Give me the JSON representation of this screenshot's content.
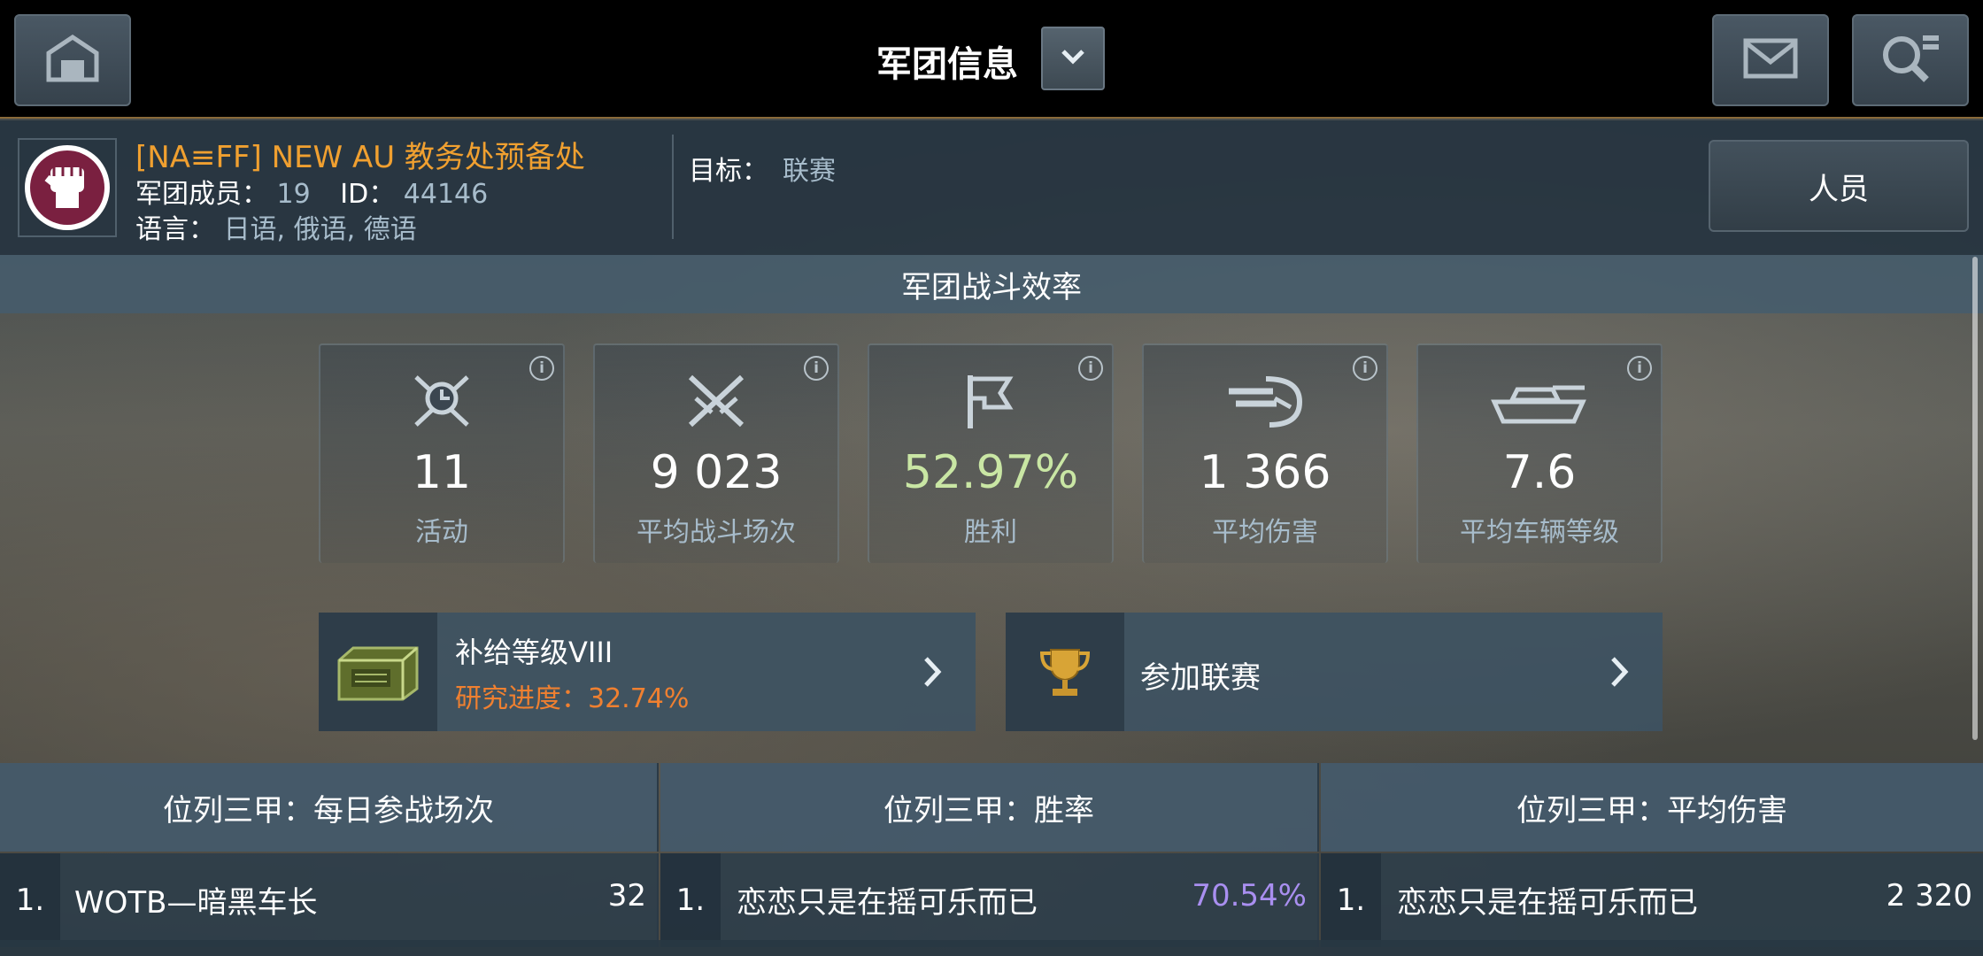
{
  "header": {
    "title": "军团信息"
  },
  "clan": {
    "name": "[NA≡FF] NEW AU 教务处预备处",
    "members_label": "军团成员：",
    "members_value": "19",
    "id_label": "ID：",
    "id_value": "44146",
    "lang_label": "语言：",
    "lang_value": "日语, 俄语, 德语",
    "goal_label": "目标：",
    "goal_value": "联赛",
    "staff_button": "人员"
  },
  "efficiency": {
    "title": "军团战斗效率",
    "stats": [
      {
        "icon": "activity-icon",
        "value": "11",
        "label": "活动"
      },
      {
        "icon": "battles-icon",
        "value": "9 023",
        "label": "平均战斗场次"
      },
      {
        "icon": "victory-flag-icon",
        "value": "52.97%",
        "label": "胜利",
        "color": "#c9e6a4"
      },
      {
        "icon": "damage-shell-icon",
        "value": "1 366",
        "label": "平均伤害"
      },
      {
        "icon": "tank-icon",
        "value": "7.6",
        "label": "平均车辆等级"
      }
    ]
  },
  "supply": {
    "title": "补给等级VIII",
    "progress_label": "研究进度：",
    "progress_value": "32.74%",
    "progress": 0.3274
  },
  "league": {
    "title": "参加联赛"
  },
  "leaderboards": [
    {
      "title": "位列三甲：每日参战场次",
      "rows": [
        {
          "rank": "1.",
          "name": "WOTB—暗黑车长",
          "value": "32"
        }
      ]
    },
    {
      "title": "位列三甲：胜率",
      "rows": [
        {
          "rank": "1.",
          "name": "恋恋只是在摇可乐而已",
          "value": "70.54%"
        }
      ]
    },
    {
      "title": "位列三甲：平均伤害",
      "rows": [
        {
          "rank": "1.",
          "name": "恋恋只是在摇可乐而已",
          "value": "2 320"
        }
      ]
    }
  ],
  "colors": {
    "clan_name": "#f0a030",
    "progress": "#f08030",
    "winrate": "#a98ff0"
  }
}
